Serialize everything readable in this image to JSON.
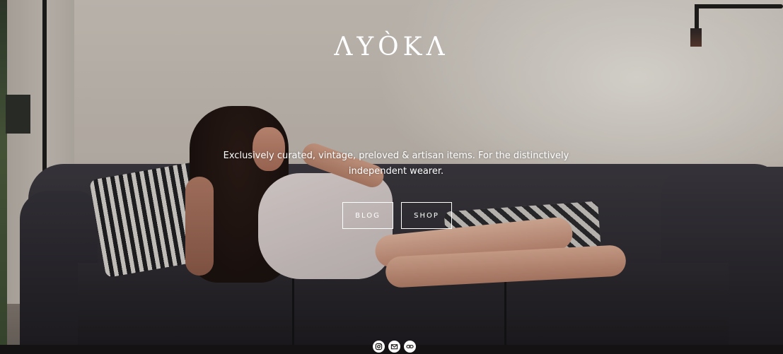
{
  "brand": {
    "logo_text": "ΛYÒKΛ"
  },
  "hero": {
    "tagline_line1": "Exclusively curated, vintage, preloved & artisan items. For the distinctively",
    "tagline_line2": "independent wearer."
  },
  "buttons": {
    "blog_label": "BLOG",
    "shop_label": "SHOP"
  },
  "social": [
    {
      "icon": "instagram-icon"
    },
    {
      "icon": "email-icon"
    },
    {
      "icon": "link-icon"
    }
  ],
  "colors": {
    "overlay_text": "#ffffff",
    "sofa": "#2b2930"
  }
}
